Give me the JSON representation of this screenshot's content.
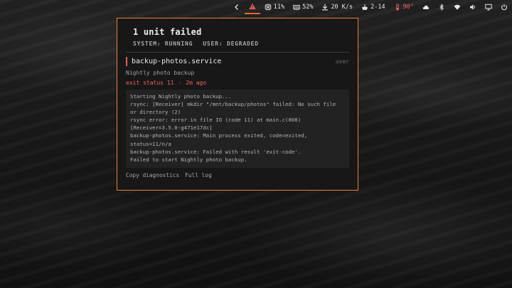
{
  "topbar": {
    "cpu": "11%",
    "memory": "52%",
    "network": "20 K/s",
    "updates": "2-14",
    "temperature": "90°"
  },
  "popup": {
    "title": "1 unit failed",
    "system_state": "SYSTEM: RUNNING",
    "user_state": "USER: DEGRADED",
    "unit": {
      "name": "backup-photos.service",
      "scope": "user",
      "description": "Nightly photo backup",
      "exit_status": "exit status 11",
      "separator": "·",
      "time_ago": "2m ago"
    },
    "log_lines": [
      "Starting Nightly photo backup...",
      "rsync: [Receiver] mkdir \"/mnt/backup/photos\" failed: No such file or directory (2)",
      "rsync error: error in file IO (code 11) at main.c(808) [Receiver=3.5.0-g471e17dc]",
      "backup-photos.service: Main process exited, code=exited, status=11/n/a",
      "backup-photos.service: Failed with result 'exit-code'.",
      "Failed to start Nightly photo backup."
    ],
    "actions": {
      "copy": "Copy diagnostics",
      "log": "Full log"
    }
  },
  "colors": {
    "accent": "#e8813a",
    "error": "#f06262",
    "panel_bg": "#171717"
  }
}
